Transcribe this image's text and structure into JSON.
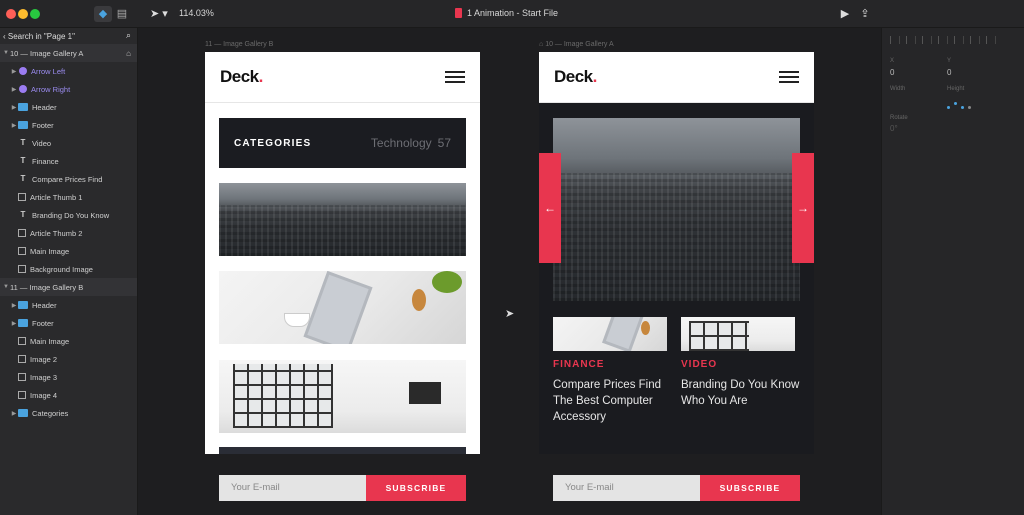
{
  "window": {
    "title": "1 Animation - Start File",
    "zoom": "114.03%"
  },
  "left_panel": {
    "search": "Search in \"Page 1\"",
    "layers": [
      {
        "label": "10 — Image Gallery A",
        "type": "group",
        "indent": 0
      },
      {
        "label": "Arrow Left",
        "type": "comp",
        "indent": 1
      },
      {
        "label": "Arrow Right",
        "type": "comp",
        "indent": 1
      },
      {
        "label": "Header",
        "type": "folder",
        "indent": 1
      },
      {
        "label": "Footer",
        "type": "folder",
        "indent": 1
      },
      {
        "label": "Video",
        "type": "text",
        "indent": 1
      },
      {
        "label": "Finance",
        "type": "text",
        "indent": 1
      },
      {
        "label": "Compare Prices Find",
        "type": "text",
        "indent": 1
      },
      {
        "label": "Article Thumb 1",
        "type": "img",
        "indent": 1
      },
      {
        "label": "Branding Do You Know",
        "type": "text",
        "indent": 1
      },
      {
        "label": "Article Thumb 2",
        "type": "img",
        "indent": 1
      },
      {
        "label": "Main Image",
        "type": "img",
        "indent": 1
      },
      {
        "label": "Background Image",
        "type": "img",
        "indent": 1
      },
      {
        "label": "11 — Image Gallery B",
        "type": "group",
        "indent": 0
      },
      {
        "label": "Header",
        "type": "folder",
        "indent": 1
      },
      {
        "label": "Footer",
        "type": "folder",
        "indent": 1
      },
      {
        "label": "Main Image",
        "type": "img",
        "indent": 1
      },
      {
        "label": "Image 2",
        "type": "img",
        "indent": 1
      },
      {
        "label": "Image 3",
        "type": "img",
        "indent": 1
      },
      {
        "label": "Image 4",
        "type": "img",
        "indent": 1
      },
      {
        "label": "Categories",
        "type": "folder",
        "indent": 1
      }
    ]
  },
  "right_panel": {
    "x_label": "X",
    "x_value": "0",
    "y_label": "Y",
    "y_value": "0",
    "width_label": "Width",
    "height_label": "Height",
    "rotate_label": "Rotate",
    "rotate_value": "0°"
  },
  "artboard_b": {
    "label": "11 — Image Gallery B",
    "logo": "Deck",
    "categories_title": "CATEGORIES",
    "category_name": "Technology",
    "category_count": "57",
    "email_placeholder": "Your E-mail",
    "subscribe": "SUBSCRIBE"
  },
  "artboard_a": {
    "label": "10 — Image Gallery A",
    "logo": "Deck",
    "arrow_left": "←",
    "arrow_right": "→",
    "article1_category": "FINANCE",
    "article1_title": "Compare Prices Find The Best Computer Accessory",
    "article2_category": "VIDEO",
    "article2_title": "Branding Do You Know Who You Are",
    "email_placeholder": "Your E-mail",
    "subscribe": "SUBSCRIBE"
  },
  "colors": {
    "accent": "#e8364f",
    "folder": "#4aa3df",
    "component": "#9b7cf2"
  }
}
